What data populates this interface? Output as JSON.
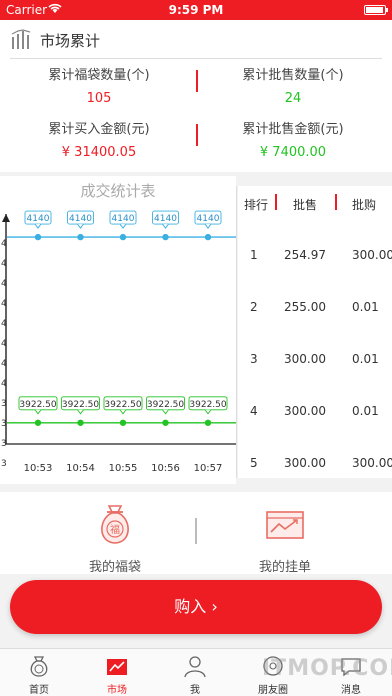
{
  "status_bar": {
    "carrier": "Carrier",
    "time": "9:59 PM"
  },
  "summary": {
    "title": "市场累计",
    "stats": [
      {
        "label": "累计福袋数量(个)",
        "value": "105",
        "color": "#ee1d23"
      },
      {
        "label": "累计批售数量(个)",
        "value": "24",
        "color": "#22c322"
      },
      {
        "label": "累计买入金额(元)",
        "value": "¥ 31400.05",
        "color": "#ee1d23"
      },
      {
        "label": "累计批售金额(元)",
        "value": "¥ 7400.00",
        "color": "#22c322"
      }
    ]
  },
  "chart_data": {
    "type": "line",
    "title": "成交统计表",
    "categories": [
      "10:53",
      "10:54",
      "10:55",
      "10:56",
      "10:57"
    ],
    "series": [
      {
        "values": [
          4140,
          4140,
          4140,
          4140,
          4140
        ],
        "color": "#3ab0e2",
        "labels": [
          "4140",
          "4140",
          "4140",
          "4140",
          "4140"
        ]
      },
      {
        "values": [
          3922.5,
          3922.5,
          3922.5,
          3922.5,
          3922.5
        ],
        "color": "#22c322",
        "labels": [
          "3922.50",
          "3922.50",
          "3922.50",
          "3922.50",
          "3922.50",
          "3"
        ]
      }
    ],
    "y_ticks": [
      "4",
      "4",
      "4",
      "4",
      "4",
      "4",
      "4",
      "4",
      "3",
      "3",
      "3",
      "3"
    ],
    "ylim": [
      3900,
      4160
    ],
    "grid": false
  },
  "ranking": {
    "headers": [
      "排行",
      "批售",
      "批购"
    ],
    "rows": [
      [
        "1",
        "254.97",
        "300.00"
      ],
      [
        "2",
        "255.00",
        "0.01"
      ],
      [
        "3",
        "300.00",
        "0.01"
      ],
      [
        "4",
        "300.00",
        "0.01"
      ],
      [
        "5",
        "300.00",
        "300.00"
      ]
    ]
  },
  "actions": {
    "my_bag": "我的福袋",
    "my_orders": "我的挂单",
    "bag_icon_char": "福"
  },
  "buy_button": "购入 ›",
  "tabs": [
    {
      "label": "首页",
      "icon": "home-icon",
      "active": false
    },
    {
      "label": "市场",
      "icon": "market-icon",
      "active": true
    },
    {
      "label": "我",
      "icon": "me-icon",
      "active": false
    },
    {
      "label": "朋友圈",
      "icon": "friends-icon",
      "active": false
    },
    {
      "label": "消息",
      "icon": "message-icon",
      "active": false
    }
  ],
  "watermark": "ITMOP.COM",
  "colors": {
    "brand_red": "#ee1d23",
    "green": "#22c322",
    "blue": "#3ab0e2"
  }
}
